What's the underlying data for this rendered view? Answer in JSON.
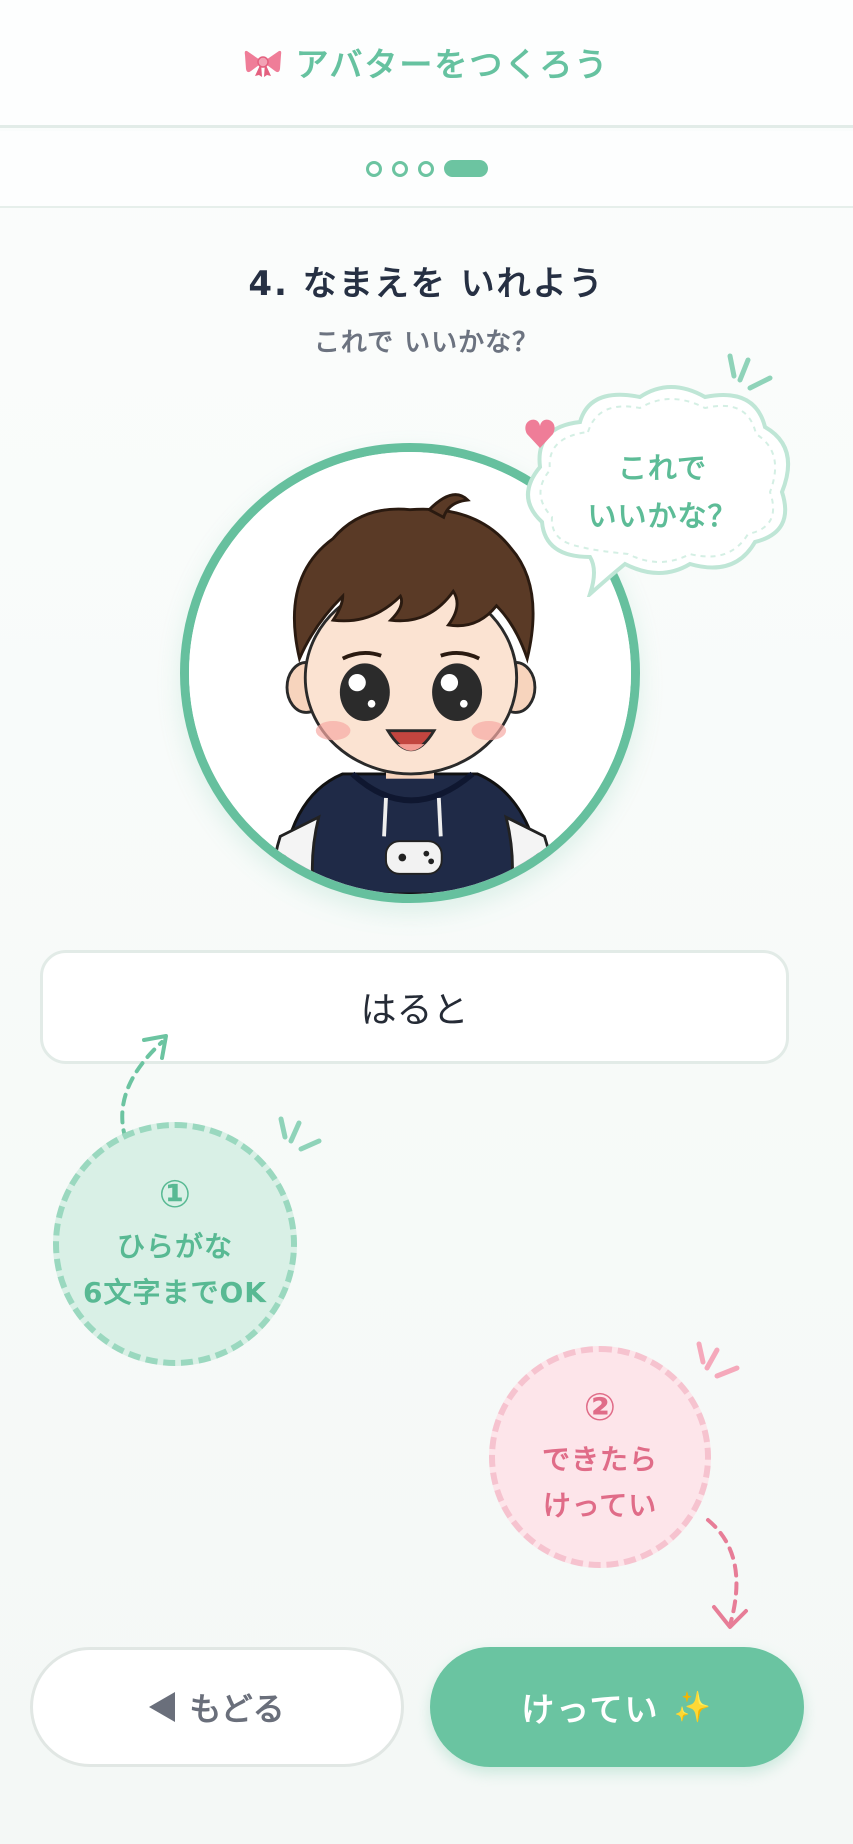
{
  "header": {
    "title": "アバターをつくろう",
    "icon": "ribbon-icon"
  },
  "progress": {
    "total_steps": 4,
    "current_step": 4
  },
  "step": {
    "title": "4. なまえを いれよう",
    "subtitle": "これで いいかな？"
  },
  "avatar": {
    "bubble_line1": "これで",
    "bubble_line2": "いいかな？"
  },
  "name_field": {
    "value": "はると"
  },
  "tips": {
    "tip1": {
      "number": "①",
      "line1": "ひらがな",
      "line2": "6文字までOK"
    },
    "tip2": {
      "number": "②",
      "line1": "できたら",
      "line2": "けってい"
    }
  },
  "buttons": {
    "back_label": "もどる",
    "confirm_label": "けってい",
    "confirm_icon": "✨"
  },
  "colors": {
    "accent": "#6ac4a1",
    "pink": "#e06c88",
    "text": "#263043"
  }
}
